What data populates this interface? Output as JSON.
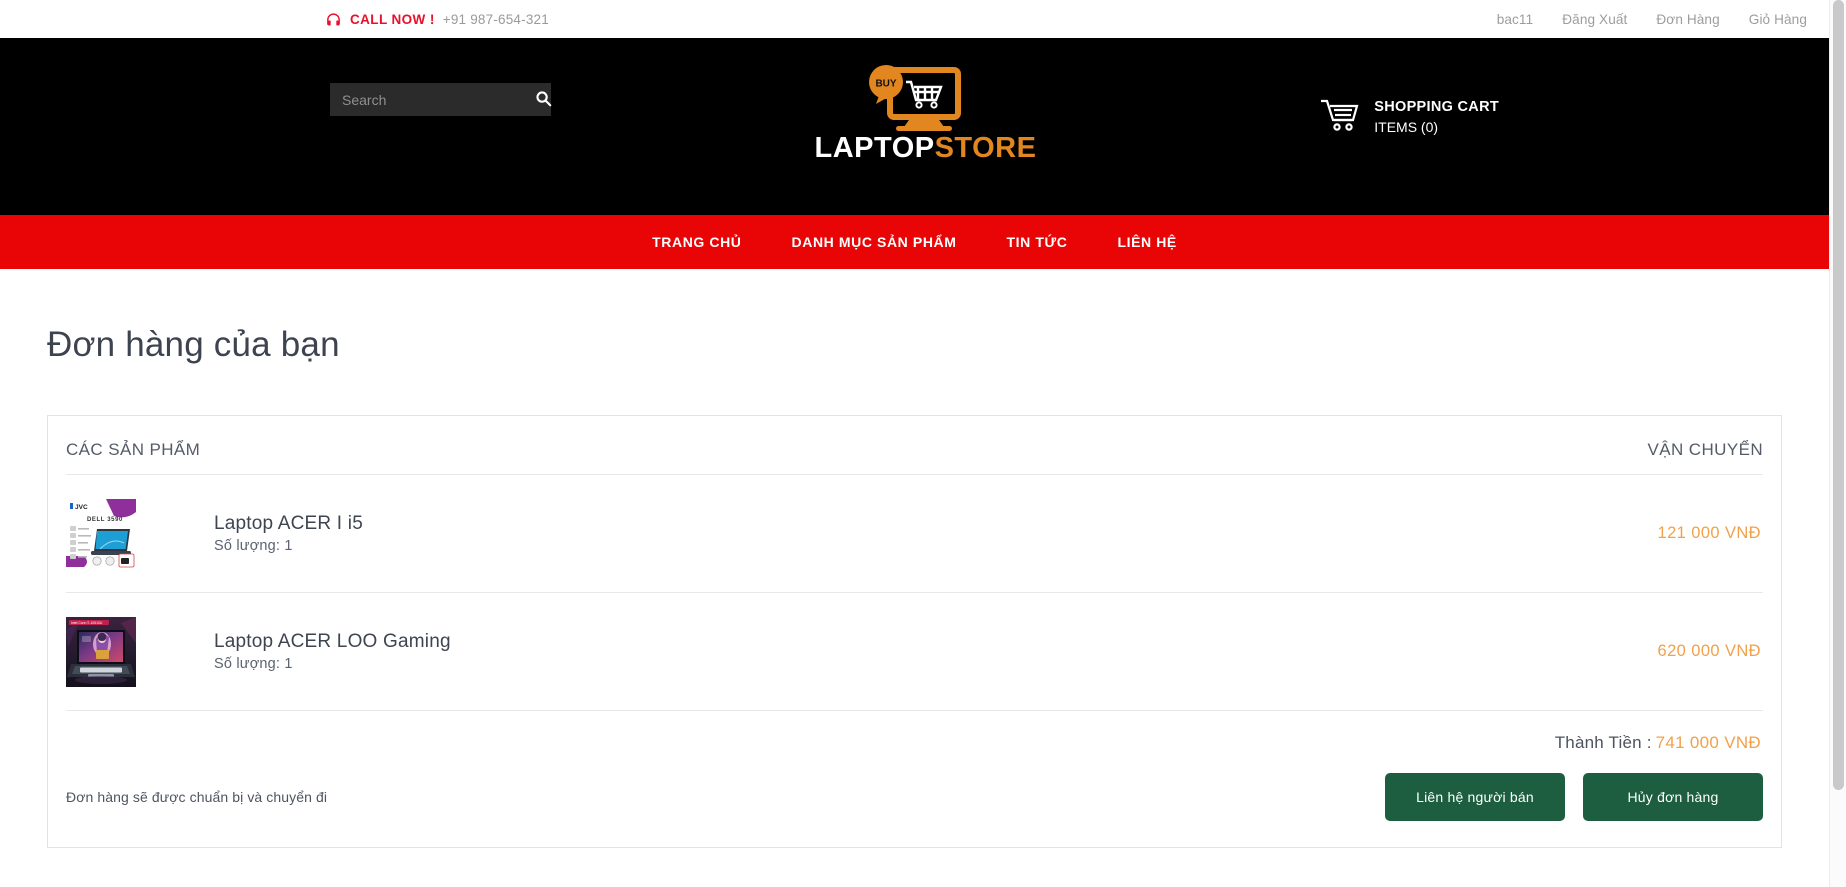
{
  "topbar": {
    "call_icon": "headset-icon",
    "call_label": "CALL NOW !",
    "call_number": "+91 987-654-321",
    "links": [
      {
        "label": "bac11"
      },
      {
        "label": "Đăng Xuất"
      },
      {
        "label": "Đơn Hàng"
      },
      {
        "label": "Giỏ Hàng"
      }
    ]
  },
  "header": {
    "search": {
      "value": "",
      "placeholder": "Search",
      "icon": "search-icon"
    },
    "logo": {
      "badge": "BUY",
      "text_primary": "LAPTOP",
      "text_secondary": "STORE",
      "icon": "laptop-cart-logo-icon",
      "color_primary": "#ffffff",
      "color_secondary": "#e2861f"
    },
    "cart": {
      "icon": "shopping-cart-icon",
      "title": "SHOPPING CART",
      "items": "ITEMS (0)"
    }
  },
  "nav": {
    "background": "#e90505",
    "items": [
      {
        "label": "TRANG CHỦ"
      },
      {
        "label": "DANH MỤC SẢN PHẨM"
      },
      {
        "label": "TIN TỨC"
      },
      {
        "label": "LIÊN HỆ"
      }
    ]
  },
  "main": {
    "page_title": "Đơn hàng của bạn",
    "card": {
      "header_left": "CÁC SẢN PHẨM",
      "header_right": "VẬN CHUYỂN",
      "products": [
        {
          "name": "Laptop ACER I i5",
          "quantity_label": "Số lượng: 1",
          "price": "121 000 VNĐ",
          "thumb": "dell-3590-laptop-thumbnail"
        },
        {
          "name": "Laptop ACER LOO Gaming",
          "quantity_label": "Số lượng: 1",
          "price": "620 000 VNĐ",
          "thumb": "acer-gaming-laptop-thumbnail"
        }
      ],
      "total_label": "Thành Tiền :",
      "total_value": "741 000 VNĐ",
      "note": "Đơn hàng sẽ được chuẩn bị và chuyển đi",
      "buttons": [
        {
          "label": "Liên hệ người bán"
        },
        {
          "label": "Hủy đơn hàng"
        }
      ],
      "accent_price_color": "#f0a14b",
      "button_color": "#1d5e40"
    }
  }
}
